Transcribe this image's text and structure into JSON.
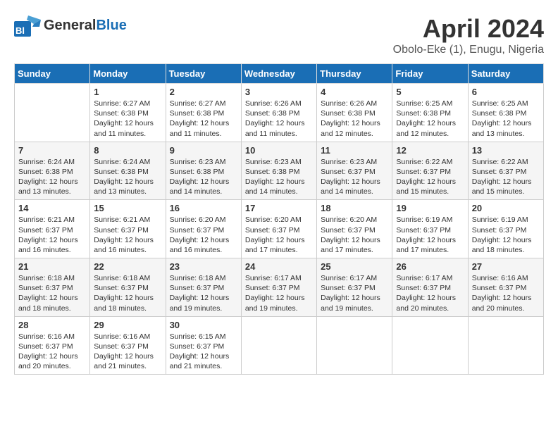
{
  "header": {
    "logo_general": "General",
    "logo_blue": "Blue",
    "title": "April 2024",
    "location": "Obolo-Eke (1), Enugu, Nigeria"
  },
  "calendar": {
    "days_of_week": [
      "Sunday",
      "Monday",
      "Tuesday",
      "Wednesday",
      "Thursday",
      "Friday",
      "Saturday"
    ],
    "weeks": [
      [
        {
          "day": "",
          "info": ""
        },
        {
          "day": "1",
          "info": "Sunrise: 6:27 AM\nSunset: 6:38 PM\nDaylight: 12 hours\nand 11 minutes."
        },
        {
          "day": "2",
          "info": "Sunrise: 6:27 AM\nSunset: 6:38 PM\nDaylight: 12 hours\nand 11 minutes."
        },
        {
          "day": "3",
          "info": "Sunrise: 6:26 AM\nSunset: 6:38 PM\nDaylight: 12 hours\nand 11 minutes."
        },
        {
          "day": "4",
          "info": "Sunrise: 6:26 AM\nSunset: 6:38 PM\nDaylight: 12 hours\nand 12 minutes."
        },
        {
          "day": "5",
          "info": "Sunrise: 6:25 AM\nSunset: 6:38 PM\nDaylight: 12 hours\nand 12 minutes."
        },
        {
          "day": "6",
          "info": "Sunrise: 6:25 AM\nSunset: 6:38 PM\nDaylight: 12 hours\nand 13 minutes."
        }
      ],
      [
        {
          "day": "7",
          "info": "Sunrise: 6:24 AM\nSunset: 6:38 PM\nDaylight: 12 hours\nand 13 minutes."
        },
        {
          "day": "8",
          "info": "Sunrise: 6:24 AM\nSunset: 6:38 PM\nDaylight: 12 hours\nand 13 minutes."
        },
        {
          "day": "9",
          "info": "Sunrise: 6:23 AM\nSunset: 6:38 PM\nDaylight: 12 hours\nand 14 minutes."
        },
        {
          "day": "10",
          "info": "Sunrise: 6:23 AM\nSunset: 6:38 PM\nDaylight: 12 hours\nand 14 minutes."
        },
        {
          "day": "11",
          "info": "Sunrise: 6:23 AM\nSunset: 6:37 PM\nDaylight: 12 hours\nand 14 minutes."
        },
        {
          "day": "12",
          "info": "Sunrise: 6:22 AM\nSunset: 6:37 PM\nDaylight: 12 hours\nand 15 minutes."
        },
        {
          "day": "13",
          "info": "Sunrise: 6:22 AM\nSunset: 6:37 PM\nDaylight: 12 hours\nand 15 minutes."
        }
      ],
      [
        {
          "day": "14",
          "info": "Sunrise: 6:21 AM\nSunset: 6:37 PM\nDaylight: 12 hours\nand 16 minutes."
        },
        {
          "day": "15",
          "info": "Sunrise: 6:21 AM\nSunset: 6:37 PM\nDaylight: 12 hours\nand 16 minutes."
        },
        {
          "day": "16",
          "info": "Sunrise: 6:20 AM\nSunset: 6:37 PM\nDaylight: 12 hours\nand 16 minutes."
        },
        {
          "day": "17",
          "info": "Sunrise: 6:20 AM\nSunset: 6:37 PM\nDaylight: 12 hours\nand 17 minutes."
        },
        {
          "day": "18",
          "info": "Sunrise: 6:20 AM\nSunset: 6:37 PM\nDaylight: 12 hours\nand 17 minutes."
        },
        {
          "day": "19",
          "info": "Sunrise: 6:19 AM\nSunset: 6:37 PM\nDaylight: 12 hours\nand 17 minutes."
        },
        {
          "day": "20",
          "info": "Sunrise: 6:19 AM\nSunset: 6:37 PM\nDaylight: 12 hours\nand 18 minutes."
        }
      ],
      [
        {
          "day": "21",
          "info": "Sunrise: 6:18 AM\nSunset: 6:37 PM\nDaylight: 12 hours\nand 18 minutes."
        },
        {
          "day": "22",
          "info": "Sunrise: 6:18 AM\nSunset: 6:37 PM\nDaylight: 12 hours\nand 18 minutes."
        },
        {
          "day": "23",
          "info": "Sunrise: 6:18 AM\nSunset: 6:37 PM\nDaylight: 12 hours\nand 19 minutes."
        },
        {
          "day": "24",
          "info": "Sunrise: 6:17 AM\nSunset: 6:37 PM\nDaylight: 12 hours\nand 19 minutes."
        },
        {
          "day": "25",
          "info": "Sunrise: 6:17 AM\nSunset: 6:37 PM\nDaylight: 12 hours\nand 19 minutes."
        },
        {
          "day": "26",
          "info": "Sunrise: 6:17 AM\nSunset: 6:37 PM\nDaylight: 12 hours\nand 20 minutes."
        },
        {
          "day": "27",
          "info": "Sunrise: 6:16 AM\nSunset: 6:37 PM\nDaylight: 12 hours\nand 20 minutes."
        }
      ],
      [
        {
          "day": "28",
          "info": "Sunrise: 6:16 AM\nSunset: 6:37 PM\nDaylight: 12 hours\nand 20 minutes."
        },
        {
          "day": "29",
          "info": "Sunrise: 6:16 AM\nSunset: 6:37 PM\nDaylight: 12 hours\nand 21 minutes."
        },
        {
          "day": "30",
          "info": "Sunrise: 6:15 AM\nSunset: 6:37 PM\nDaylight: 12 hours\nand 21 minutes."
        },
        {
          "day": "",
          "info": ""
        },
        {
          "day": "",
          "info": ""
        },
        {
          "day": "",
          "info": ""
        },
        {
          "day": "",
          "info": ""
        }
      ]
    ]
  }
}
